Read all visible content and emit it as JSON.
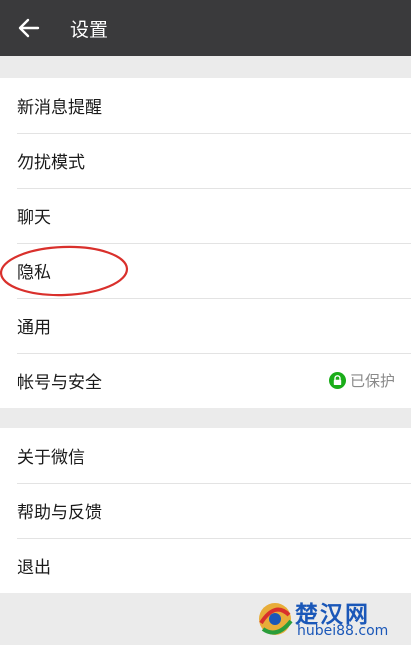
{
  "header": {
    "title": "设置",
    "back_icon": "arrow-left-icon"
  },
  "group1": {
    "items": [
      {
        "label": "新消息提醒"
      },
      {
        "label": "勿扰模式"
      },
      {
        "label": "聊天"
      },
      {
        "label": "隐私"
      },
      {
        "label": "通用"
      },
      {
        "label": "帐号与安全",
        "status": "已保护",
        "status_color": "#1aad19"
      }
    ]
  },
  "group2": {
    "items": [
      {
        "label": "关于微信"
      },
      {
        "label": "帮助与反馈"
      },
      {
        "label": "退出"
      }
    ]
  },
  "annotation": {
    "color": "#d9302c"
  },
  "watermark": {
    "name": "楚汉网",
    "url": "hubei88.com"
  }
}
